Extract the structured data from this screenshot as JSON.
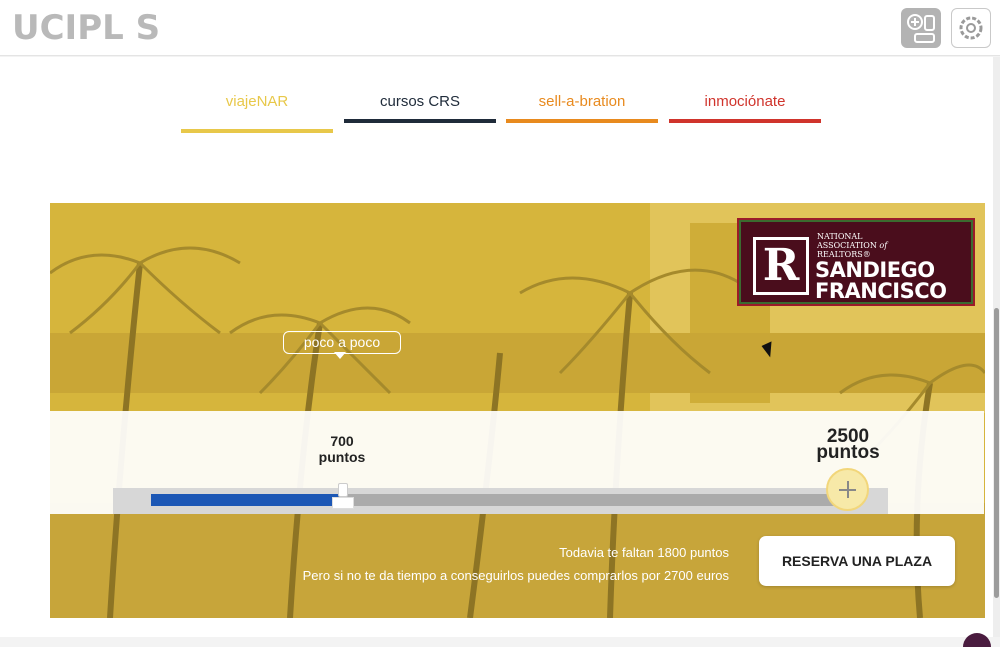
{
  "header": {
    "logo_text": "UCIPL  S",
    "add_icon": "add-widget-icon",
    "settings_icon": "gear-icon"
  },
  "tabs": [
    {
      "label": "viajeNAR",
      "color": "#e8c84a"
    },
    {
      "label": "cursos CRS",
      "color": "#1f2b3a"
    },
    {
      "label": "sell-a-bration",
      "color": "#e88a1e"
    },
    {
      "label": "inmociónate",
      "color": "#d0342c"
    }
  ],
  "banner": {
    "badge_small": "NATIONAL\nASSOCIATION of\nREALTORS®",
    "badge_letter": "R",
    "badge_title_1": "SANDIEGO",
    "badge_title_2": "FRANCISCO",
    "bubble": "poco a poco",
    "bg_color": "#d8b73a"
  },
  "slider": {
    "current_value": "700",
    "current_unit": "puntos",
    "max_value": "2500",
    "max_unit": "puntos",
    "progress": 0.28,
    "fill_color": "#1c57b5"
  },
  "message": {
    "line1": "Todavia te faltan 1800 puntos",
    "line2": "Pero si no te da tiempo a conseguirlos puedes comprarlos por 2700 euros"
  },
  "reserve_button": "RESERVA UNA PLAZA"
}
